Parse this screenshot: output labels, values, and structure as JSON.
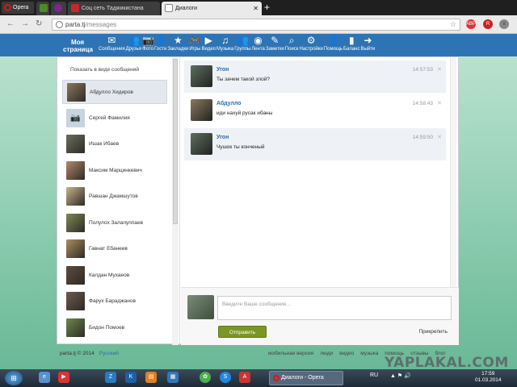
{
  "browser": {
    "menu_label": "Opera",
    "tabs": [
      {
        "label": "",
        "icon": "f-icon",
        "color": "#4b8b2b"
      },
      {
        "label": "",
        "icon": "s-icon",
        "color": "#7a2a8a"
      },
      {
        "label": "Соц сеть Таджикистана",
        "icon": "sm-icon",
        "color": "#c62828"
      },
      {
        "label": "Диалоги",
        "icon": "page-icon",
        "color": "#888888",
        "active": true
      }
    ],
    "url_host": "parta.tj",
    "url_path": "/messages"
  },
  "site": {
    "accent": "#2e74b4",
    "my_page_label": "Моя страница",
    "nav": [
      {
        "label": "Сообщения",
        "icon": "envelope-icon",
        "glyph": "✉"
      },
      {
        "label": "Друзья",
        "icon": "friends-icon",
        "glyph": "👥"
      },
      {
        "label": "Фото",
        "icon": "camera-icon",
        "glyph": "📷"
      },
      {
        "label": "Гости",
        "icon": "guests-icon",
        "glyph": "👤"
      },
      {
        "label": "Закладки",
        "icon": "star-icon",
        "glyph": "★"
      },
      {
        "label": "Игры",
        "icon": "gamepad-icon",
        "glyph": "🎮"
      },
      {
        "label": "Видео",
        "icon": "video-icon",
        "glyph": "▶"
      },
      {
        "label": "Музыка",
        "icon": "music-icon",
        "glyph": "♫"
      },
      {
        "label": "Группы",
        "icon": "groups-icon",
        "glyph": "👥"
      },
      {
        "label": "Лента",
        "icon": "globe-icon",
        "glyph": "◉"
      },
      {
        "label": "Заметки",
        "icon": "pencil-icon",
        "glyph": "✎"
      },
      {
        "label": "Поиск",
        "icon": "search-icon",
        "glyph": "⌕"
      },
      {
        "label": "Настройки",
        "icon": "gear-icon",
        "glyph": "⚙"
      },
      {
        "label": "Помощь",
        "icon": "help-icon",
        "glyph": "👤"
      },
      {
        "label": "Баланс",
        "icon": "balance-icon",
        "glyph": "▮"
      },
      {
        "label": "Выйти",
        "icon": "exit-icon",
        "glyph": "➜"
      }
    ]
  },
  "sidebar": {
    "show_link": "Показать в виде сообщений",
    "contacts": [
      {
        "name": "Абдулло Хидиров",
        "selected": true,
        "color": "#8a7a5c"
      },
      {
        "name": "Сергей Фамилия",
        "color": "#c8d4e0",
        "placeholder": true
      },
      {
        "name": "Ишак Ибаев",
        "color": "#6a6f5a"
      },
      {
        "name": "Максим Марцинкевич",
        "color": "#b28a6a"
      },
      {
        "name": "Равшан Джамшутов",
        "color": "#c9b48a"
      },
      {
        "name": "Полулох Залапуппаев",
        "color": "#7d8a55"
      },
      {
        "name": "Гавнат Ебанеев",
        "color": "#aa9060"
      },
      {
        "name": "Калдан Мухаеов",
        "color": "#5c4c40"
      },
      {
        "name": "Фарух Бараджанов",
        "color": "#6b5b52"
      },
      {
        "name": "Бидон Помоев",
        "color": "#6c8a50"
      }
    ]
  },
  "messages": [
    {
      "author": "Угон",
      "text": "Ты зачем такой злой?",
      "time": "14:57:53",
      "alt": true,
      "color": "#5d6f5d"
    },
    {
      "author": "Абдулло",
      "text": "иди нахуй русак ибаны",
      "time": "14:58:43",
      "alt": false,
      "color": "#8a7a5c"
    },
    {
      "author": "Угон",
      "text": "Чушок ты конченый",
      "time": "14:59:50",
      "alt": true,
      "color": "#5d6f5d"
    }
  ],
  "compose": {
    "placeholder": "Введите Ваше сообщение...",
    "send_label": "Отправить",
    "attach_label": "Прикрепить"
  },
  "footer": {
    "copyright": "parta.tj © 2014",
    "lang": "Русский",
    "links": [
      "мобильная версия",
      "люди",
      "видео",
      "музыка",
      "помощь",
      "отзывы",
      "блог"
    ]
  },
  "watermark": "YAPLAKAL.COM",
  "taskbar": {
    "task_label": "Диалоги - Opera",
    "lang": "RU",
    "time": "17:59",
    "date": "01.03.2014"
  }
}
